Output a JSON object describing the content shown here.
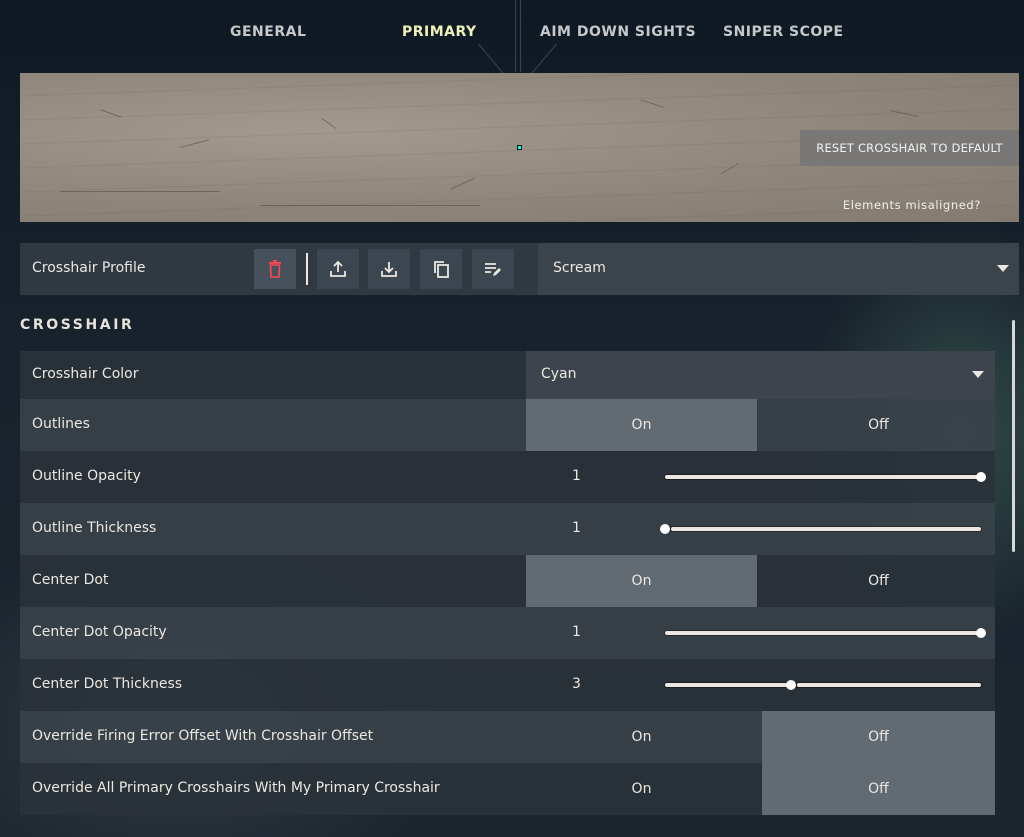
{
  "tabs": [
    {
      "label": "GENERAL",
      "active": false
    },
    {
      "label": "PRIMARY",
      "active": true
    },
    {
      "label": "AIM DOWN SIGHTS",
      "active": false
    },
    {
      "label": "SNIPER SCOPE",
      "active": false
    }
  ],
  "preview": {
    "reset_label": "RESET CROSSHAIR TO DEFAULT",
    "misaligned_label": "Elements misaligned?",
    "crosshair_color": "#00ffff"
  },
  "profile": {
    "label": "Crosshair Profile",
    "selected": "Scream",
    "icons": [
      "trash-icon",
      "upload-icon",
      "download-icon",
      "copy-icon",
      "edit-list-icon"
    ],
    "delete_color": "#ff4655"
  },
  "section": {
    "title": "CROSSHAIR"
  },
  "settings": {
    "color": {
      "label": "Crosshair Color",
      "value": "Cyan"
    },
    "outlines": {
      "label": "Outlines",
      "on": "On",
      "off": "Off",
      "selected": "On"
    },
    "outline_opacity": {
      "label": "Outline Opacity",
      "value": "1",
      "fraction": 1.0
    },
    "outline_thickness": {
      "label": "Outline Thickness",
      "value": "1",
      "fraction": 0.0
    },
    "center_dot": {
      "label": "Center Dot",
      "on": "On",
      "off": "Off",
      "selected": "On"
    },
    "center_dot_opacity": {
      "label": "Center Dot Opacity",
      "value": "1",
      "fraction": 1.0
    },
    "center_dot_thickness": {
      "label": "Center Dot Thickness",
      "value": "3",
      "fraction": 0.4
    },
    "override_firing_error": {
      "label": "Override Firing Error Offset With Crosshair Offset",
      "on": "On",
      "off": "Off",
      "selected": "Off"
    },
    "override_all_primary": {
      "label": "Override All Primary Crosshairs With My Primary Crosshair",
      "on": "On",
      "off": "Off",
      "selected": "Off"
    }
  }
}
